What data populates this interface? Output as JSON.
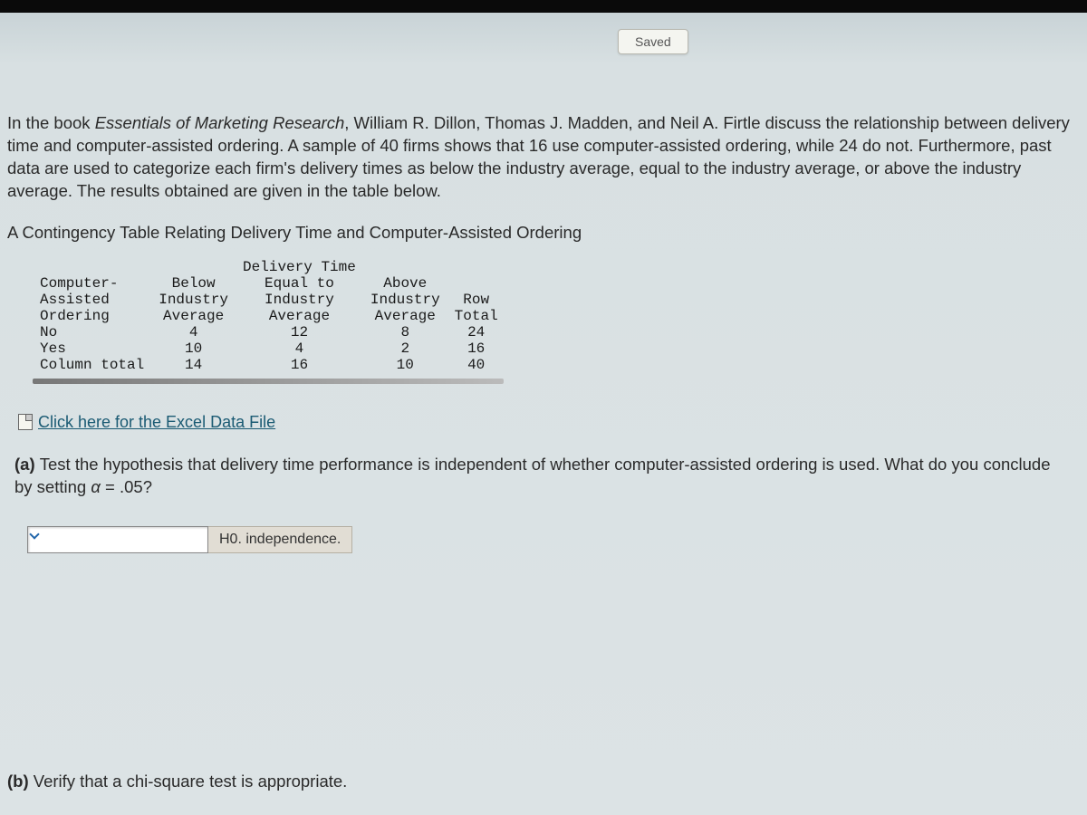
{
  "saved_label": "Saved",
  "intro": {
    "prefix": "In the book ",
    "book_title": "Essentials of Marketing Research",
    "rest": ", William R. Dillon, Thomas J. Madden, and Neil A. Firtle discuss the relationship between delivery time and computer-assisted ordering. A sample of 40 firms shows that 16 use computer-assisted ordering, while 24 do not. Furthermore, past data are used to categorize each firm's delivery times as below the industry average, equal to the industry average, or above the industry average. The results obtained are given in the table below."
  },
  "table_title": "A Contingency Table Relating Delivery Time and Computer-Assisted Ordering",
  "table": {
    "group_header": "Delivery Time",
    "row_header_lines": [
      "Computer-",
      "Assisted",
      "Ordering"
    ],
    "col_headers": {
      "c1": [
        "Below",
        "Industry",
        "Average"
      ],
      "c2": [
        "Equal to",
        "Industry",
        "Average"
      ],
      "c3": [
        "Above",
        "Industry",
        "Average"
      ],
      "c4": [
        "",
        "Row",
        "Total"
      ]
    },
    "rows": [
      {
        "label": "No",
        "c1": "4",
        "c2": "12",
        "c3": "8",
        "c4": "24"
      },
      {
        "label": "Yes",
        "c1": "10",
        "c2": "4",
        "c3": "2",
        "c4": "16"
      },
      {
        "label": "Column total",
        "c1": "14",
        "c2": "16",
        "c3": "10",
        "c4": "40"
      }
    ]
  },
  "excel_link": "Click here for the Excel Data File",
  "question_a": {
    "label": "(a) ",
    "text_before_alpha": "Test the hypothesis that delivery time performance is independent of whether computer-assisted ordering is used. What do you conclude by setting ",
    "alpha": "α",
    "text_after_alpha": " = .05?"
  },
  "hypothesis_label": "H0. independence.",
  "question_b": {
    "label": "(b) ",
    "text": "Verify that a chi-square test is appropriate."
  }
}
